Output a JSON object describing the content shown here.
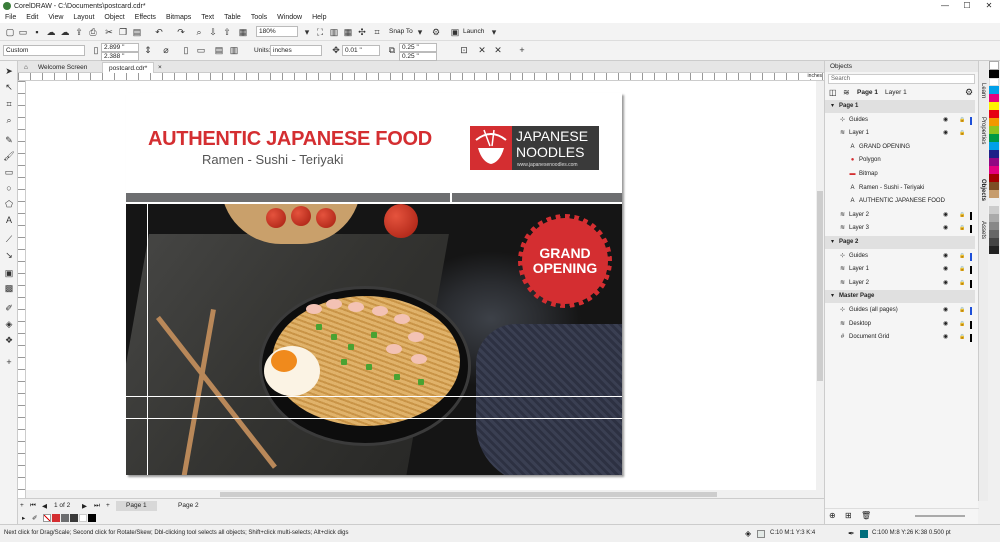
{
  "window": {
    "title": "CorelDRAW - C:\\Documents\\postcard.cdr*",
    "min": "—",
    "max": "☐",
    "close": "✕"
  },
  "menu": [
    "File",
    "Edit",
    "View",
    "Layout",
    "Object",
    "Effects",
    "Bitmaps",
    "Text",
    "Table",
    "Tools",
    "Window",
    "Help"
  ],
  "toolbar": {
    "zoom": "180%",
    "snap_to": "Snap To",
    "launch": "Launch"
  },
  "property_bar": {
    "preset": "Custom",
    "width": "2.899 \"",
    "height": "2.388 \"",
    "units_label": "Units:",
    "units": "inches",
    "nudge": "0.01 \"",
    "dup_x": "0.25 \"",
    "dup_y": "0.25 \""
  },
  "doc_tabs": [
    "Welcome Screen",
    "postcard.cdr*"
  ],
  "ruler_units": "inches",
  "design": {
    "headline": "AUTHENTIC JAPANESE FOOD",
    "subline": "Ramen - Sushi - Teriyaki",
    "logo_line1": "JAPANESE",
    "logo_line2": "NOODLES",
    "logo_url": "www.japanesenoodles.com",
    "badge_line1": "GRAND",
    "badge_line2": "OPENING"
  },
  "pages": {
    "counter": "1 of 2",
    "tabs": [
      "Page 1",
      "Page 2"
    ]
  },
  "objects_panel": {
    "title": "Objects",
    "search_placeholder": "Search",
    "current_page": "Page 1",
    "current_layer": "Layer 1",
    "rows": [
      {
        "label": "Page 1",
        "level": 0,
        "kind": "page"
      },
      {
        "label": "Guides",
        "level": 1,
        "kind": "guides",
        "swatch": "#1e4fd8"
      },
      {
        "label": "Layer 1",
        "level": 1,
        "kind": "layer"
      },
      {
        "label": "GRAND OPENING",
        "level": 2,
        "kind": "text"
      },
      {
        "label": "Polygon",
        "level": 2,
        "kind": "polygon"
      },
      {
        "label": "Bitmap",
        "level": 2,
        "kind": "bitmap"
      },
      {
        "label": "Ramen - Sushi - Teriyaki",
        "level": 2,
        "kind": "text"
      },
      {
        "label": "AUTHENTIC JAPANESE FOOD",
        "level": 2,
        "kind": "text"
      },
      {
        "label": "Layer 2",
        "level": 1,
        "kind": "layer",
        "swatch": "#000000"
      },
      {
        "label": "Layer 3",
        "level": 1,
        "kind": "layer",
        "swatch": "#000000"
      },
      {
        "label": "Page 2",
        "level": 0,
        "kind": "page"
      },
      {
        "label": "Guides",
        "level": 1,
        "kind": "guides",
        "swatch": "#1e4fd8"
      },
      {
        "label": "Layer 1",
        "level": 1,
        "kind": "layer",
        "swatch": "#000000"
      },
      {
        "label": "Layer 2",
        "level": 1,
        "kind": "layer",
        "swatch": "#000000"
      },
      {
        "label": "Master Page",
        "level": 0,
        "kind": "page"
      },
      {
        "label": "Guides (all pages)",
        "level": 1,
        "kind": "guides",
        "swatch": "#1e4fd8"
      },
      {
        "label": "Desktop",
        "level": 1,
        "kind": "layer",
        "swatch": "#000000"
      },
      {
        "label": "Document Grid",
        "level": 1,
        "kind": "grid",
        "swatch": "#000000"
      }
    ]
  },
  "side_tabs": [
    "Learn",
    "Properties",
    "Objects",
    "Assets"
  ],
  "status": {
    "hint": "Next click for Drag/Scale; Second click for Rotate/Skew; Dbl-clicking tool selects all objects; Shift+click multi-selects; Alt+click digs",
    "fill": "C:10 M:1 Y:3 K:4",
    "outline": "C:100 M:8 Y:26 K:38  0.500 pt"
  },
  "colors": {
    "accent": "#d42e31",
    "dark": "#3a3a3a"
  }
}
